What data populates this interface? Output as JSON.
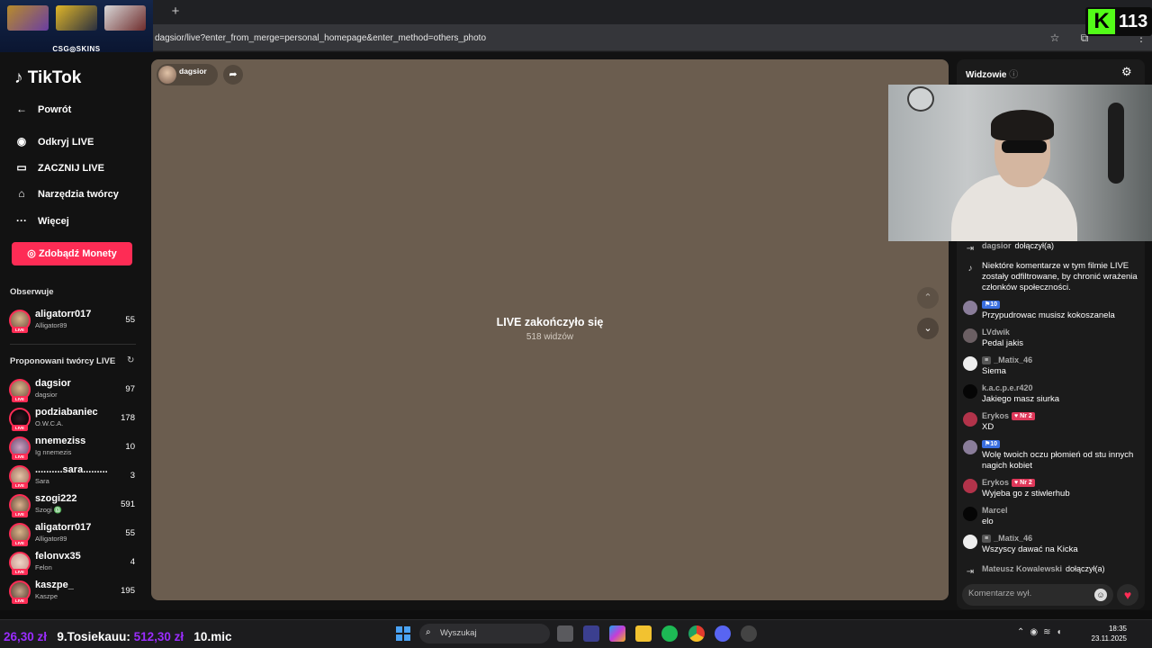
{
  "browser": {
    "new_tab": "+",
    "url": "dagsior/live?enter_from_merge=personal_homepage&enter_method=others_photo"
  },
  "overlay": {
    "ad_brand": "CSG◎SKINS",
    "kick_logo": "K",
    "kick_viewers": "113"
  },
  "sidebar": {
    "logo": "TikTok",
    "nav": [
      {
        "label": "Powrót",
        "icon": "back-arrow-icon"
      },
      {
        "label": "Odkryj LIVE",
        "icon": "explore-live-icon"
      },
      {
        "label": "ZACZNIJ LIVE",
        "icon": "camera-icon"
      },
      {
        "label": "Narzędzia twórcy",
        "icon": "creator-tools-icon"
      },
      {
        "label": "Więcej",
        "icon": "more-dots-icon"
      }
    ],
    "coins_button": "Zdobądź Monety",
    "following_header": "Obserwuje",
    "following": [
      {
        "name": "aligatorr017",
        "sub": "Alligator89",
        "count": "55"
      }
    ],
    "suggested_header": "Proponowani twórcy LIVE",
    "suggested": [
      {
        "name": "dagsior",
        "sub": "dagsior",
        "count": "97"
      },
      {
        "name": "podziabaniec",
        "sub": "O.W.C.A.",
        "count": "178"
      },
      {
        "name": "nnemeziss",
        "sub": "Ig nnemezis",
        "count": "10"
      },
      {
        "name": "..........sara.........",
        "sub": "Sara",
        "count": "3"
      },
      {
        "name": "szogi222",
        "sub": "Szogi ♎",
        "count": "591"
      },
      {
        "name": "aligatorr017",
        "sub": "Alligator89",
        "count": "55"
      },
      {
        "name": "felonvx35",
        "sub": "Felon",
        "count": "4"
      },
      {
        "name": "kaszpe_",
        "sub": "Kaszpe",
        "count": "195"
      }
    ],
    "live_badge": "LIVE"
  },
  "player": {
    "host_name": "dagsior",
    "ended_title": "LIVE zakończyło się",
    "viewers": "518 widzów"
  },
  "chat": {
    "header": "Widzowie",
    "messages": [
      {
        "user": "dagsior",
        "inline": "dołączył(a)",
        "text": "",
        "type": "join"
      },
      {
        "user": "",
        "inline": "",
        "text": "Niektóre komentarze w tym filmie LIVE zostały odfiltrowane, by chronić wrażenia członków społeczności.",
        "type": "system"
      },
      {
        "user": "",
        "badge_level": "10",
        "text": "Przypudrowac musisz kokoszanela",
        "type": "msg",
        "avatar": "#8a7d9a"
      },
      {
        "user": "LVdwik",
        "text": "Pedal jakis",
        "type": "msg",
        "avatar": "#6b5f63"
      },
      {
        "user": "_Matix_46",
        "mod": "≡",
        "text": "Siema",
        "type": "msg",
        "avatar": "#eeeeee"
      },
      {
        "user": "k.a.c.p.e.r420",
        "text": "Jakiego masz siurka",
        "type": "msg",
        "avatar": "#1b1b1b"
      },
      {
        "user": "Erykos",
        "fan": "Nr 2",
        "text": "XD",
        "type": "msg",
        "avatar": "#b2334a"
      },
      {
        "user": "",
        "badge_level": "10",
        "text": "Wolę twoich oczu płomień od stu innych nagich kobiet",
        "type": "msg",
        "avatar": "#8a7d9a"
      },
      {
        "user": "Erykos",
        "fan": "Nr 2",
        "text": "Wyjeba go z stiwlerhub",
        "type": "msg",
        "avatar": "#b2334a"
      },
      {
        "user": "Marcel",
        "text": "elo",
        "type": "msg",
        "avatar": "#1b1b1b"
      },
      {
        "user": "_Matix_46",
        "mod": "≡",
        "text": "Wszyscy dawać na Kicka",
        "type": "msg",
        "avatar": "#eeeeee"
      },
      {
        "user": "Mateusz Kowalewski",
        "inline": "dołączył(a)",
        "text": "",
        "type": "join"
      }
    ],
    "comment_placeholder": "Komentarze wył."
  },
  "ticker": {
    "amount1": "26,30 zł",
    "rank9": "9.Tosiekauu:",
    "amount2": "512,30 zł",
    "rank10": "10.mic"
  },
  "taskbar": {
    "search_label": "Wyszukaj",
    "time": "18:35",
    "date": "23.11.2025"
  },
  "colors": {
    "accent": "#fe2c55",
    "player_bg": "#6b5d4f",
    "kick_green": "#53fc18",
    "ticker_amount": "#9b2cff"
  }
}
